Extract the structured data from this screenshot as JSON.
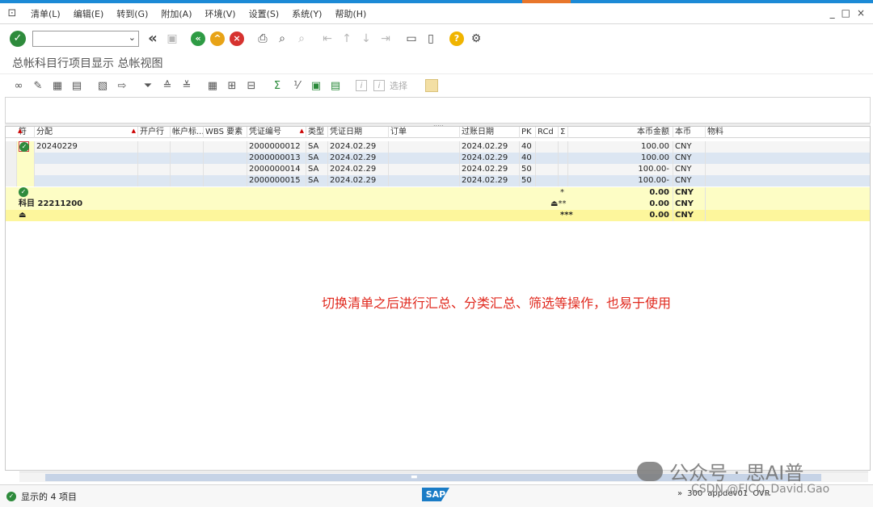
{
  "menubar": {
    "items": [
      "清单(L)",
      "编辑(E)",
      "转到(G)",
      "附加(A)",
      "环境(V)",
      "设置(S)",
      "系统(Y)",
      "帮助(H)"
    ],
    "window_controls": [
      "_",
      "□",
      "×"
    ]
  },
  "system_toolbar": {
    "command_field_value": "",
    "icons": [
      "enter-icon",
      "back-double-icon",
      "save-icon",
      "back-icon",
      "exit-icon",
      "cancel-icon",
      "print-icon",
      "find-icon",
      "find-next-icon",
      "first-page-icon",
      "previous-page-icon",
      "next-page-icon",
      "last-page-icon",
      "create-session-icon",
      "shortcut-icon",
      "help-icon",
      "settings-icon"
    ]
  },
  "title": "总帐科目行项目显示 总帐视图",
  "app_toolbar": {
    "select_label": "选择"
  },
  "grid": {
    "columns": [
      "符",
      "分配",
      "开户行",
      "帐户标...",
      "WBS 要素",
      "凭证编号",
      "类型",
      "凭证日期",
      "订单",
      "过账日期",
      "PK",
      "RCd",
      "Σ",
      "本币金额",
      "本币",
      "物料"
    ],
    "rows": [
      {
        "assignment": "20240229",
        "doc_no": "2000000012",
        "type": "SA",
        "doc_date": "2024.02.29",
        "post_date": "2024.02.29",
        "pk": "40",
        "amount": "100.00",
        "currency": "CNY"
      },
      {
        "assignment": "",
        "doc_no": "2000000013",
        "type": "SA",
        "doc_date": "2024.02.29",
        "post_date": "2024.02.29",
        "pk": "40",
        "amount": "100.00",
        "currency": "CNY"
      },
      {
        "assignment": "",
        "doc_no": "2000000014",
        "type": "SA",
        "doc_date": "2024.02.29",
        "post_date": "2024.02.29",
        "pk": "50",
        "amount": "100.00-",
        "currency": "CNY"
      },
      {
        "assignment": "",
        "doc_no": "2000000015",
        "type": "SA",
        "doc_date": "2024.02.29",
        "post_date": "2024.02.29",
        "pk": "50",
        "amount": "100.00-",
        "currency": "CNY"
      }
    ],
    "subtotal": {
      "marker": "*",
      "amount": "0.00",
      "currency": "CNY"
    },
    "account_total": {
      "label": "科目 22211200",
      "marker": "**",
      "amount": "0.00",
      "currency": "CNY"
    },
    "grand_total": {
      "marker": "***",
      "amount": "0.00",
      "currency": "CNY"
    }
  },
  "annotation": "切换清单之后进行汇总、分类汇总、筛选等操作，也易于使用",
  "status": {
    "message": "显示的 4 项目",
    "brand": "SAP",
    "right_items": [
      "»",
      "300",
      "appdev01",
      "OVR"
    ]
  },
  "watermark": {
    "text": "公众号 · 思AI普",
    "text2": "CSDN @FICO_David.Gao"
  },
  "colors": {
    "accent_blue": "#1c8ad6",
    "ok_green": "#2e8b3c",
    "row_alt_blue": "#dce6f2",
    "subtotal_yellow": "#fdfdc5",
    "total_yellow": "#fdf69c",
    "annotation_red": "#e0281d"
  }
}
